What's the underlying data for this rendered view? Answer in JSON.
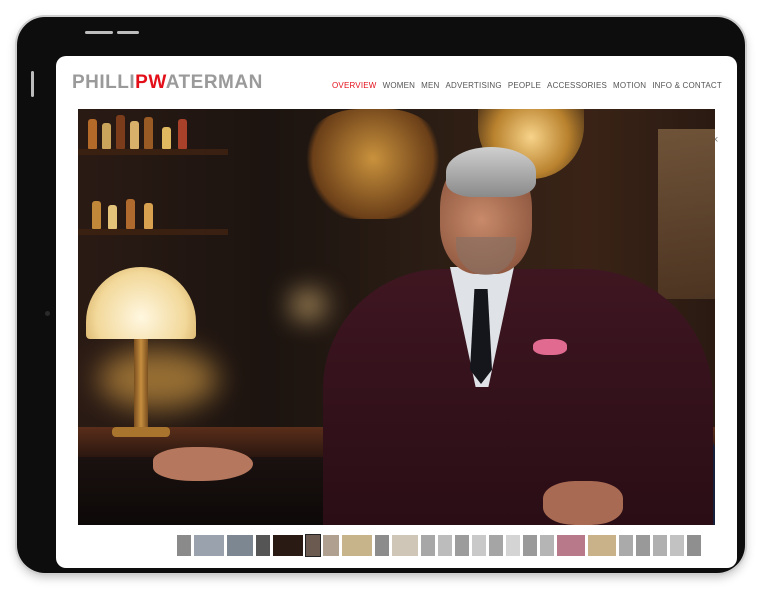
{
  "site": {
    "logo_pre": "PHILLI",
    "logo_mid": "PW",
    "logo_post": "ATERMAN",
    "logo_pre_color": "#9a9a9a",
    "logo_accent_color": "#e3101a"
  },
  "nav": {
    "items": [
      "OVERVIEW",
      "WOMEN",
      "MEN",
      "ADVERTISING",
      "PEOPLE",
      "ACCESSORIES",
      "MOTION",
      "INFO & CONTACT"
    ],
    "active_index": 0,
    "active_color": "#e3101a"
  },
  "viewer": {
    "close_glyph": "×",
    "thumbnail_count": 25,
    "selected_thumbnail_index": 5
  }
}
